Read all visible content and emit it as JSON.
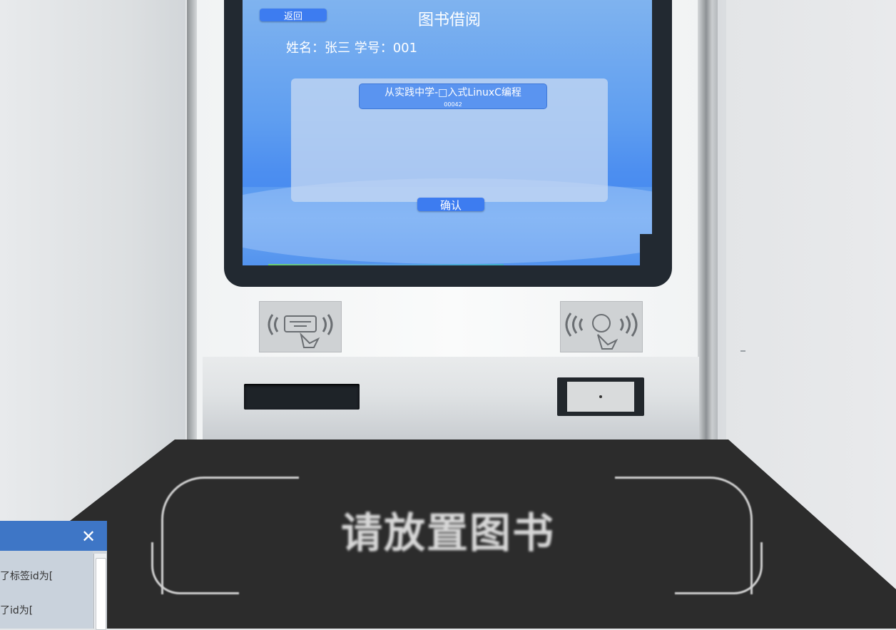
{
  "screen": {
    "back_label": "返回",
    "title": "图书借阅",
    "user_info": "姓名：张三  学号：001",
    "book": {
      "title": "从实践中学-□入式LinuxC编程",
      "id": "00042"
    },
    "confirm_label": "确认"
  },
  "tray": {
    "label": "请放置图书"
  },
  "log_window": {
    "close_label": "✕",
    "lines": [
      "了标签id为[",
      "了id为["
    ]
  },
  "colors": {
    "button_blue": "#3d7cf0",
    "bezel": "#222931",
    "log_header": "#3e76c6"
  },
  "icons": {
    "left_pad": "rfid-card-icon",
    "right_pad": "rfid-tag-icon"
  }
}
